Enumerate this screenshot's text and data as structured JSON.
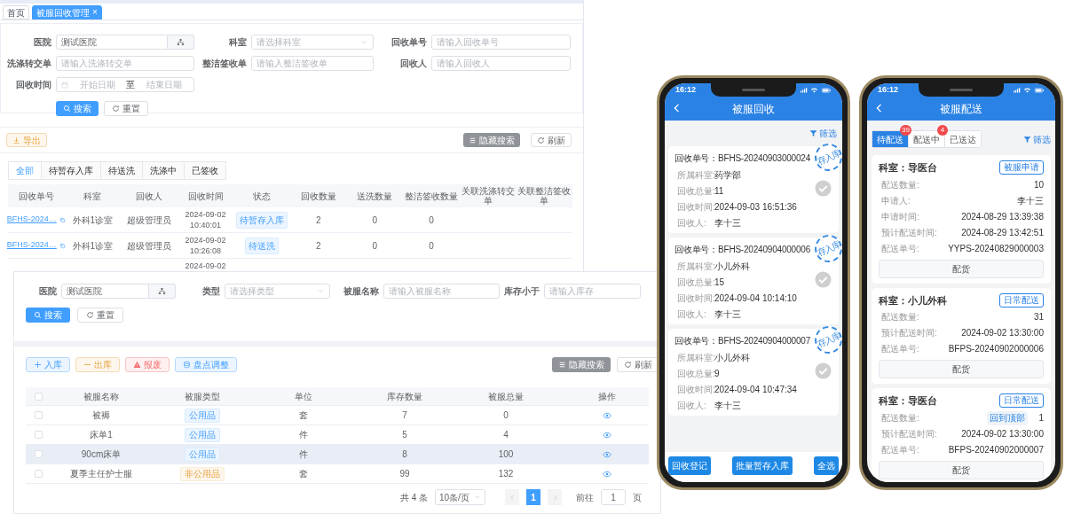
{
  "recycle_admin": {
    "tabs": [
      {
        "label": "首页",
        "selected": false
      },
      {
        "label": "被服回收管理",
        "selected": true,
        "close": "×"
      }
    ],
    "filters": [
      {
        "label": "医院",
        "kind": "picker",
        "value": "测试医院"
      },
      {
        "label": "科室",
        "kind": "select",
        "placeholder": "请选择科室"
      },
      {
        "label": "回收单号",
        "kind": "text",
        "placeholder": "请输入回收单号"
      },
      {
        "label": "洗涤转交单",
        "kind": "text",
        "placeholder": "请输入洗涤转交单"
      },
      {
        "label": "整洁签收单",
        "kind": "text",
        "placeholder": "请输入整洁签收单"
      },
      {
        "label": "回收人",
        "kind": "text",
        "placeholder": "请输入回收人"
      },
      {
        "label": "回收时间",
        "kind": "daterange",
        "start_placeholder": "开始日期",
        "separator": "至",
        "end_placeholder": "结束日期"
      }
    ],
    "search_button": "搜索",
    "reset_button": "重置",
    "export_button": "导出",
    "hide_search_button": "隐藏搜索",
    "refresh_button": "刷新",
    "status_tabs": [
      {
        "label": "全部",
        "selected": true
      },
      {
        "label": "待暂存入库",
        "selected": false
      },
      {
        "label": "待送洗",
        "selected": false
      },
      {
        "label": "洗涤中",
        "selected": false
      },
      {
        "label": "已签收",
        "selected": false
      }
    ],
    "table": {
      "columns": [
        "回收单号",
        "科室",
        "回收人",
        "回收时间",
        "状态",
        "回收数量",
        "送洗数量",
        "整洁签收数量",
        "关联洗涤转交单",
        "关联整洁签收单"
      ],
      "rows": [
        {
          "order_no": "BFHS-2024…",
          "department": "外科1诊室",
          "collector": "超级管理员",
          "time": [
            "2024-09-02",
            "10:40:01"
          ],
          "status": "待暂存入库",
          "recycle_qty": "2",
          "wash_qty": "0",
          "sign_qty": "0"
        },
        {
          "order_no": "BFHS-2024…",
          "department": "外科1诊室",
          "collector": "超级管理员",
          "time": [
            "2024-09-02",
            "10:26:08"
          ],
          "status": "待送洗",
          "recycle_qty": "2",
          "wash_qty": "0",
          "sign_qty": "0"
        },
        {
          "time": [
            "2024-09-02"
          ]
        }
      ]
    }
  },
  "stock_admin": {
    "filters": [
      {
        "label": "医院",
        "kind": "picker",
        "value": "测试医院"
      },
      {
        "label": "类型",
        "kind": "select",
        "placeholder": "请选择类型"
      },
      {
        "label": "被服名称",
        "kind": "text",
        "placeholder": "请输入被服名称"
      },
      {
        "label": "库存小于",
        "kind": "text",
        "placeholder": "请输入库存"
      }
    ],
    "search_button": "搜索",
    "reset_button": "重置",
    "actions": [
      {
        "label": "入库",
        "kind": "in"
      },
      {
        "label": "出库",
        "kind": "out"
      },
      {
        "label": "报废",
        "kind": "scrap"
      },
      {
        "label": "盘点调整",
        "kind": "adjust"
      }
    ],
    "hide_search_button": "隐藏搜索",
    "refresh_button": "刷新",
    "table": {
      "select_all_checked": false,
      "columns": [
        "被服名称",
        "被服类型",
        "单位",
        "库存数量",
        "被服总量",
        "操作"
      ],
      "rows": [
        {
          "checked": false,
          "highlighted": false,
          "name": "被褥",
          "type": "公用品",
          "kind": "public",
          "unit": "套",
          "stock": "7",
          "total": "0"
        },
        {
          "checked": false,
          "highlighted": false,
          "name": "床单1",
          "type": "公用品",
          "kind": "public",
          "unit": "件",
          "stock": "5",
          "total": "4"
        },
        {
          "checked": false,
          "highlighted": true,
          "name": "90cm床单",
          "type": "公用品",
          "kind": "public",
          "unit": "件",
          "stock": "8",
          "total": "100"
        },
        {
          "checked": false,
          "highlighted": false,
          "name": "夏季主任护士服",
          "type": "非公用品",
          "kind": "nonpublic",
          "unit": "套",
          "stock": "99",
          "total": "132"
        }
      ]
    },
    "pagination": {
      "total": "共 4 条",
      "page_size": "10条/页",
      "pages": [
        {
          "label": "1",
          "selected": true
        }
      ],
      "goto_label": "前往",
      "goto_value": "1",
      "page_suffix": "页"
    }
  },
  "recycle_phone": {
    "time": "16:12",
    "title": "被服回收",
    "filter": "筛选",
    "cards": [
      {
        "order_label": "回收单号：",
        "order_no": "BFHS-20240903000024",
        "stamp": "存入库",
        "checked": false,
        "fields": [
          {
            "label": "所属科室:",
            "value": "药学部"
          },
          {
            "label": "回收总量:",
            "value": "11"
          },
          {
            "label": "回收时间:",
            "value": "2024-09-03 16:51:36"
          },
          {
            "label": "回收人:",
            "value": "李十三"
          }
        ]
      },
      {
        "order_label": "回收单号：",
        "order_no": "BFHS-20240904000006",
        "stamp": "存入库",
        "checked": false,
        "fields": [
          {
            "label": "所属科室:",
            "value": "小儿外科"
          },
          {
            "label": "回收总量:",
            "value": "15"
          },
          {
            "label": "回收时间:",
            "value": "2024-09-04 10:14:10"
          },
          {
            "label": "回收人:",
            "value": "李十三"
          }
        ]
      },
      {
        "order_label": "回收单号：",
        "order_no": "BFHS-20240904000007",
        "stamp": "存入库",
        "checked": false,
        "fields": [
          {
            "label": "所属科室:",
            "value": "小儿外科"
          },
          {
            "label": "回收总量:",
            "value": "9"
          },
          {
            "label": "回收时间:",
            "value": "2024-09-04 10:47:34"
          },
          {
            "label": "回收人:",
            "value": "李十三"
          }
        ]
      }
    ],
    "footer_buttons": [
      "回收登记",
      "批量暂存入库",
      "全选"
    ]
  },
  "delivery_phone": {
    "time": "16:12",
    "title": "被服配送",
    "filter": "筛选",
    "tabs": [
      {
        "label": "待配送",
        "badge": "39",
        "selected": true
      },
      {
        "label": "配送中",
        "badge": "4",
        "selected": false
      },
      {
        "label": "已送达",
        "selected": false
      }
    ],
    "cards": [
      {
        "dept_label": "科室：",
        "dept": "导医台",
        "tag": "被服申请",
        "button": "配货",
        "fields": [
          {
            "label": "配送数量:",
            "value": "10"
          },
          {
            "label": "申请人:",
            "value": "李十三"
          },
          {
            "label": "申请时间:",
            "value": "2024-08-29 13:39:38"
          },
          {
            "label": "预计配送时间:",
            "value": "2024-08-29 13:42:51"
          },
          {
            "label": "配送单号:",
            "value": "YYPS-20240829000003"
          }
        ]
      },
      {
        "dept_label": "科室：",
        "dept": "小儿外科",
        "tag": "日常配送",
        "button": "配货",
        "fields": [
          {
            "label": "配送数量:",
            "value": "31"
          },
          {
            "label": "预计配送时间:",
            "value": "2024-09-02 13:30:00"
          },
          {
            "label": "配送单号:",
            "value": "BFPS-20240902000006"
          }
        ]
      },
      {
        "dept_label": "科室：",
        "dept": "导医台",
        "tag": "日常配送",
        "button": "配货",
        "fields": [
          {
            "label": "配送数量:",
            "value": "1"
          },
          {
            "label": "预计配送时间:",
            "value": "2024-09-02 13:30:00"
          },
          {
            "label": "配送单号:",
            "value": "BFPS-20240902000007"
          }
        ]
      }
    ],
    "back_to_top": "回到顶部"
  }
}
